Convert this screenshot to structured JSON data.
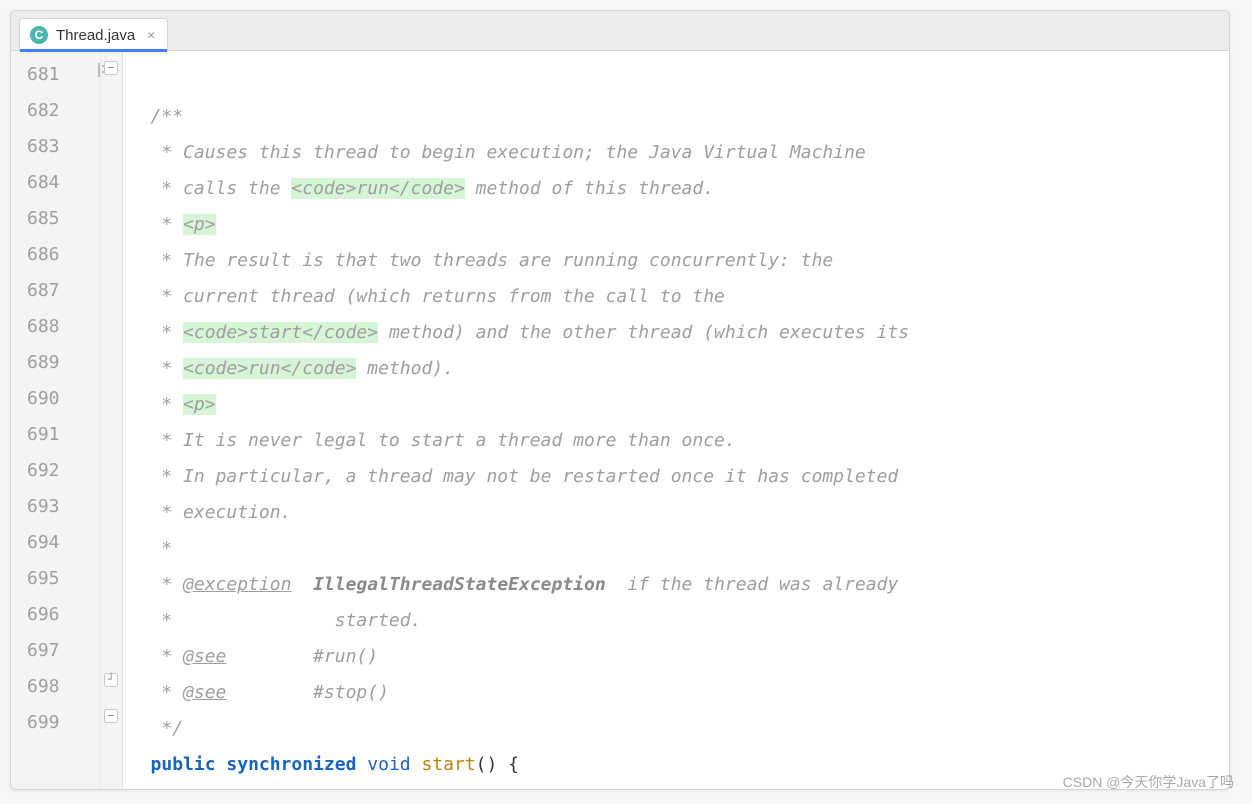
{
  "tab": {
    "filename": "Thread.java",
    "icon_letter": "C"
  },
  "line_start": 681,
  "lines": [
    {
      "n": 681,
      "marker": "struct",
      "fold": "minus",
      "seg": [
        {
          "t": "/**",
          "c": "cmt"
        }
      ]
    },
    {
      "n": 682,
      "seg": [
        {
          "t": " * Causes this thread to begin execution; the Java Virtual Machine",
          "c": "cmt"
        }
      ]
    },
    {
      "n": 683,
      "seg": [
        {
          "t": " * calls the ",
          "c": "cmt"
        },
        {
          "t": "<code>",
          "c": "hl"
        },
        {
          "t": "run",
          "c": "hl"
        },
        {
          "t": "</code>",
          "c": "hl"
        },
        {
          "t": " method of this thread.",
          "c": "cmt"
        }
      ]
    },
    {
      "n": 684,
      "seg": [
        {
          "t": " * ",
          "c": "cmt"
        },
        {
          "t": "<p>",
          "c": "hl"
        }
      ]
    },
    {
      "n": 685,
      "seg": [
        {
          "t": " * The result is that two threads are running concurrently: the",
          "c": "cmt"
        }
      ]
    },
    {
      "n": 686,
      "seg": [
        {
          "t": " * current thread (which returns from the call to the",
          "c": "cmt"
        }
      ]
    },
    {
      "n": 687,
      "seg": [
        {
          "t": " * ",
          "c": "cmt"
        },
        {
          "t": "<code>",
          "c": "hl"
        },
        {
          "t": "start",
          "c": "hl"
        },
        {
          "t": "</code>",
          "c": "hl"
        },
        {
          "t": " method) and the other thread (which executes its",
          "c": "cmt"
        }
      ]
    },
    {
      "n": 688,
      "seg": [
        {
          "t": " * ",
          "c": "cmt"
        },
        {
          "t": "<code>",
          "c": "hl"
        },
        {
          "t": "run",
          "c": "hl"
        },
        {
          "t": "</code>",
          "c": "hl"
        },
        {
          "t": " method).",
          "c": "cmt"
        }
      ]
    },
    {
      "n": 689,
      "seg": [
        {
          "t": " * ",
          "c": "cmt"
        },
        {
          "t": "<p>",
          "c": "hl"
        }
      ]
    },
    {
      "n": 690,
      "seg": [
        {
          "t": " * It is never legal to start a thread more than once.",
          "c": "cmt"
        }
      ]
    },
    {
      "n": 691,
      "seg": [
        {
          "t": " * In particular, a thread may not be restarted once it has completed",
          "c": "cmt"
        }
      ]
    },
    {
      "n": 692,
      "seg": [
        {
          "t": " * execution.",
          "c": "cmt"
        }
      ]
    },
    {
      "n": 693,
      "seg": [
        {
          "t": " *",
          "c": "cmt"
        }
      ]
    },
    {
      "n": 694,
      "seg": [
        {
          "t": " * ",
          "c": "cmt"
        },
        {
          "t": "@exception",
          "c": "cmt-u"
        },
        {
          "t": "  ",
          "c": "cmt"
        },
        {
          "t": "IllegalThreadStateException",
          "c": "cmt-b"
        },
        {
          "t": "  if the thread was already",
          "c": "cmt"
        }
      ]
    },
    {
      "n": 695,
      "seg": [
        {
          "t": " *               started.",
          "c": "cmt"
        }
      ]
    },
    {
      "n": 696,
      "seg": [
        {
          "t": " * ",
          "c": "cmt"
        },
        {
          "t": "@see",
          "c": "cmt-u"
        },
        {
          "t": "        #run()",
          "c": "cmt"
        }
      ]
    },
    {
      "n": 697,
      "seg": [
        {
          "t": " * ",
          "c": "cmt"
        },
        {
          "t": "@see",
          "c": "cmt-u"
        },
        {
          "t": "        #stop()",
          "c": "cmt"
        }
      ]
    },
    {
      "n": 698,
      "fold": "end",
      "seg": [
        {
          "t": " */",
          "c": "cmt"
        }
      ]
    },
    {
      "n": 699,
      "fold": "minus",
      "seg": [
        {
          "t": "public",
          "c": "kw"
        },
        {
          "t": " ",
          "c": "punc"
        },
        {
          "t": "synchronized",
          "c": "kw"
        },
        {
          "t": " ",
          "c": "punc"
        },
        {
          "t": "void",
          "c": "kw2"
        },
        {
          "t": " ",
          "c": "punc"
        },
        {
          "t": "start",
          "c": "mname"
        },
        {
          "t": "() {",
          "c": "punc"
        }
      ]
    }
  ],
  "watermark": "CSDN @今天你学Java了吗"
}
